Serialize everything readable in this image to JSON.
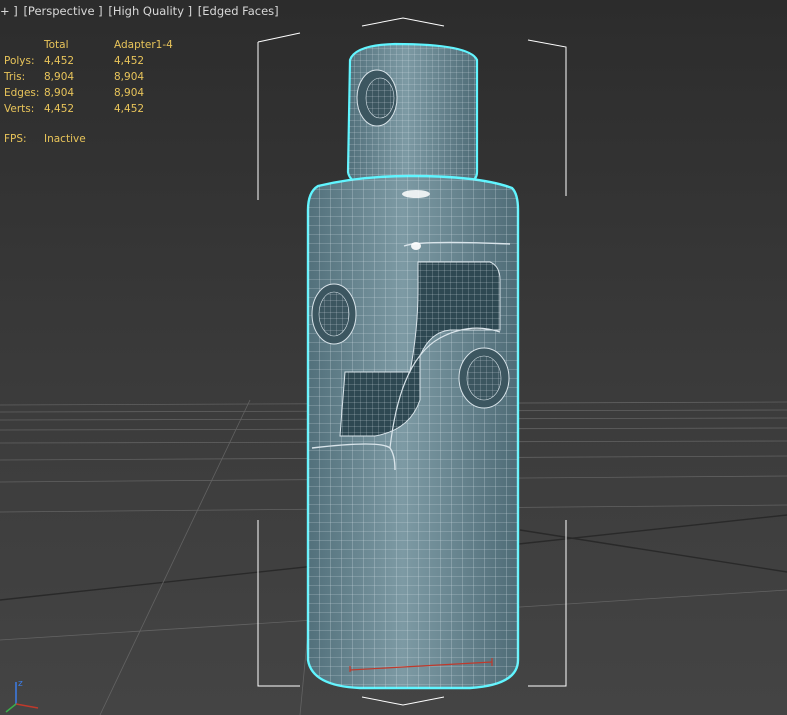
{
  "viewport_label": {
    "plus": "+ ]",
    "view": "[Perspective ]",
    "quality": "[High Quality ]",
    "shading": "[Edged Faces]"
  },
  "stats": {
    "headers": [
      "",
      "Total",
      "Adapter1-4"
    ],
    "rows": [
      {
        "label": "Polys:",
        "total": "4,452",
        "selected": "4,452"
      },
      {
        "label": "Tris:",
        "total": "8,904",
        "selected": "8,904"
      },
      {
        "label": "Edges:",
        "total": "8,904",
        "selected": "8,904"
      },
      {
        "label": "Verts:",
        "total": "4,452",
        "selected": "4,452"
      }
    ],
    "fps_label": "FPS:",
    "fps_value": "Inactive"
  },
  "gizmo": {
    "z_label": "z"
  },
  "colors": {
    "selection_outline": "#5ff5ff",
    "mesh_fill": "#6a8893",
    "wire": "#d9e4ea",
    "stat_text": "#e8c45a",
    "grid": "#6e6e6e"
  },
  "scene_object": "Adapter1-4"
}
